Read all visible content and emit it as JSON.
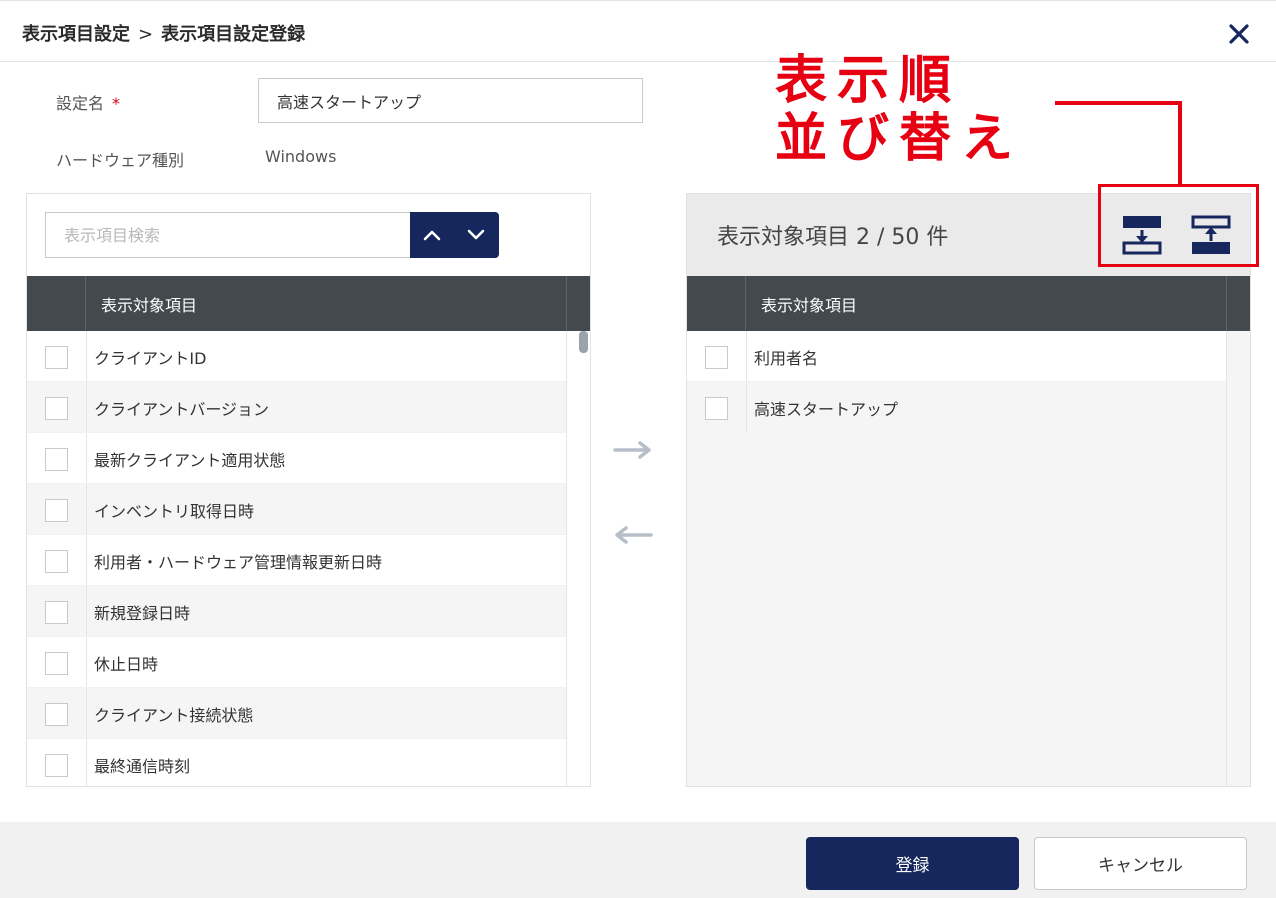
{
  "header": {
    "breadcrumb_parent": "表示項目設定",
    "breadcrumb_separator": ">",
    "breadcrumb_current": "表示項目設定登録",
    "close_icon": "close-icon"
  },
  "form": {
    "setting_name_label": "設定名",
    "required_mark": "*",
    "setting_name_value": "高速スタートアップ",
    "hardware_type_label": "ハードウェア種別",
    "hardware_type_value": "Windows"
  },
  "left_panel": {
    "search_placeholder": "表示項目検索",
    "search_up_icon": "chevron-up-icon",
    "search_down_icon": "chevron-down-icon",
    "column_header": "表示対象項目",
    "items": [
      "クライアントID",
      "クライアントバージョン",
      "最新クライアント適用状態",
      "インベントリ取得日時",
      "利用者・ハードウェア管理情報更新日時",
      "新規登録日時",
      "休止日時",
      "クライアント接続状態",
      "最終通信時刻"
    ]
  },
  "move_controls": {
    "add_icon": "arrow-right-icon",
    "remove_icon": "arrow-left-icon"
  },
  "right_panel": {
    "title": "表示対象項目 2 / 50 件",
    "sort_down_icon": "move-to-bottom-icon",
    "sort_up_icon": "move-to-top-icon",
    "column_header": "表示対象項目",
    "items": [
      "利用者名",
      "高速スタートアップ"
    ]
  },
  "annotation": {
    "line1": "表示順",
    "line2": "並び替え",
    "color": "#e60012"
  },
  "footer": {
    "register_label": "登録",
    "cancel_label": "キャンセル"
  },
  "colors": {
    "primary": "#15275c",
    "table_header": "#424a4e",
    "annotation": "#e60012"
  }
}
